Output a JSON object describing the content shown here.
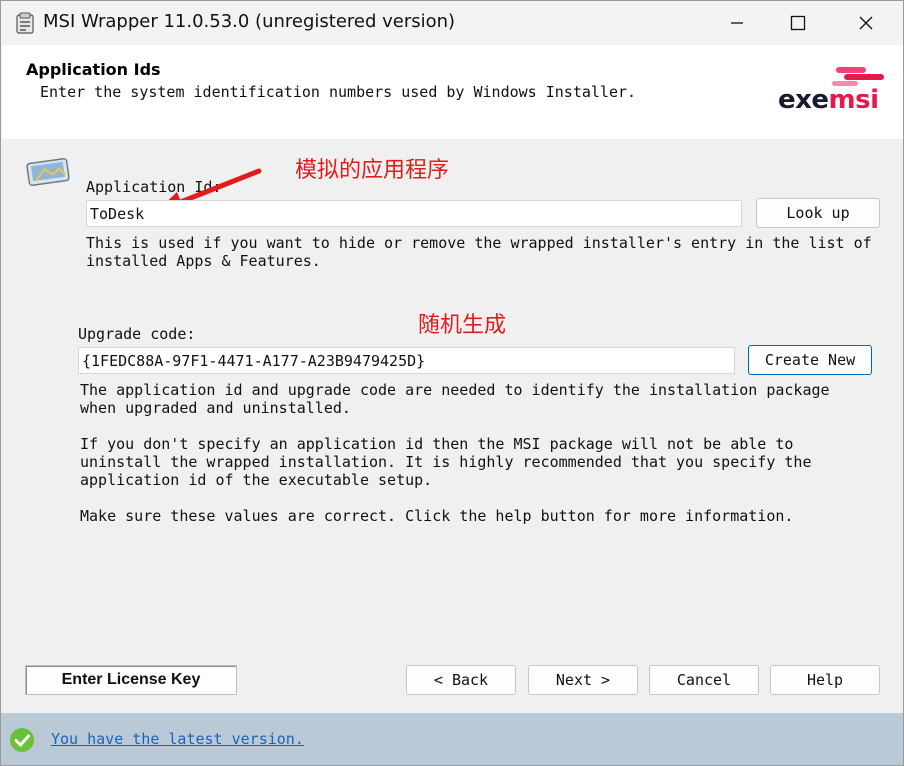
{
  "window": {
    "title": "MSI Wrapper 11.0.53.0 (unregistered version)"
  },
  "header": {
    "title": "Application Ids",
    "subtitle": "Enter the system identification numbers used by Windows Installer.",
    "logo": {
      "part1": "exe",
      "part2": "msi"
    }
  },
  "app_id": {
    "label": "Application Id:",
    "value": "ToDesk",
    "lookup_button": "Look up",
    "help_line1": "This is used if you want to hide or remove the wrapped installer's entry in the list of",
    "help_line2": "installed Apps & Features."
  },
  "annotations": {
    "app_id_note": "模拟的应用程序",
    "upgrade_note": "随机生成"
  },
  "upgrade": {
    "label": "Upgrade code:",
    "value": "{1FEDC88A-97F1-4471-A177-A23B9479425D}",
    "create_button": "Create New"
  },
  "info": {
    "p1_line1": "The application id and upgrade code are needed to identify the installation package",
    "p1_line2": "when upgraded and uninstalled.",
    "p2_line1": "If you don't specify an application id then the MSI package will not be able to",
    "p2_line2": "uninstall the wrapped installation. It is highly recommended that you specify the",
    "p2_line3": "application id of the executable setup.",
    "p3_line1": "Make sure these values are correct. Click the help button for more information."
  },
  "footer": {
    "license_button": "Enter License Key",
    "back_button": "< Back",
    "next_button": "Next >",
    "cancel_button": "Cancel",
    "help_button": "Help"
  },
  "status": {
    "link_text": "You have the latest version."
  },
  "colors": {
    "annotation": "#e21b1b",
    "logo_dark": "#1a1a2e",
    "logo_accent": "#e6194b",
    "status_bg": "#b9c9d6",
    "link": "#1a64b8",
    "check": "#6bbf3a"
  }
}
